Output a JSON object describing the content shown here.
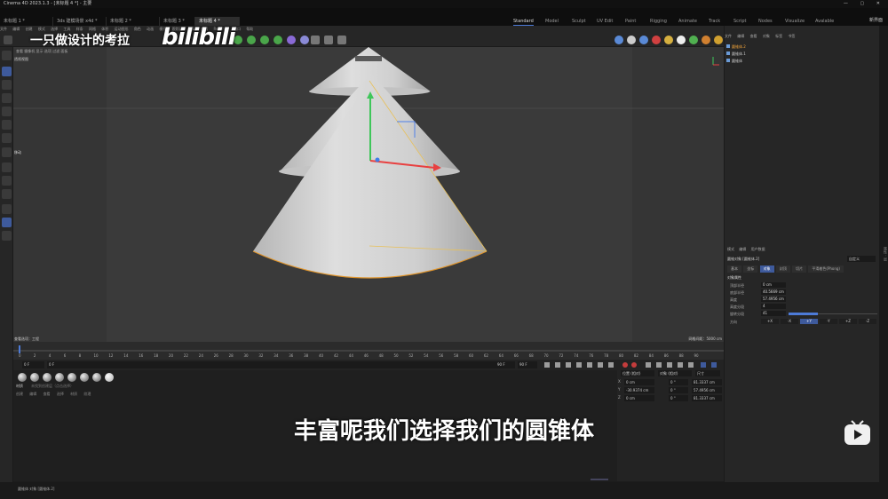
{
  "window": {
    "title": "Cinema 4D 2023.1.3 - [未标题 4 *] - 主要"
  },
  "doc_tabs": [
    {
      "label": "未标题 1 *",
      "active": false
    },
    {
      "label": "3ds 建模场景 x4d *",
      "active": false
    },
    {
      "label": "未标题 2 *",
      "active": false
    },
    {
      "label": "未标题 3 *",
      "active": false
    },
    {
      "label": "未标题 4 *",
      "active": true
    }
  ],
  "layout_tabs": [
    "Standard",
    "Model",
    "Sculpt",
    "UV Edit",
    "Paint",
    "Rigging",
    "Animate",
    "Track",
    "Script",
    "Nodes",
    "Visualize",
    "Avalable"
  ],
  "new_space": "新界面",
  "menu": [
    "文件",
    "编辑",
    "创建",
    "模式",
    "选择",
    "工具",
    "样条",
    "网格",
    "体积",
    "运动图形",
    "角色",
    "动画",
    "模拟",
    "跟踪器",
    "渲染",
    "扩展",
    "Redshift",
    "窗口",
    "帮助"
  ],
  "overlay": {
    "channel_title": "一只做设计的考拉",
    "logo": "bilibili"
  },
  "viewport": {
    "header_menu": "查看  摄像机  显示  选项  过滤  面板",
    "view_name": "透视视图",
    "move_label": "移动",
    "speed_label": "查看选项：工程",
    "grid_label": "网格间距：5000 cm"
  },
  "timeline": {
    "frames": [
      "0",
      "2",
      "4",
      "6",
      "8",
      "10",
      "12",
      "14",
      "16",
      "18",
      "20",
      "22",
      "24",
      "26",
      "28",
      "30",
      "32",
      "34",
      "36",
      "38",
      "40",
      "42",
      "44",
      "46",
      "48",
      "50",
      "52",
      "54",
      "56",
      "58",
      "60",
      "62",
      "64",
      "66",
      "68",
      "70",
      "72",
      "74",
      "76",
      "78",
      "80",
      "82",
      "84",
      "86",
      "88",
      "90"
    ],
    "current": "0 F",
    "start": "0 F",
    "end": "90 F",
    "end2": "90 F"
  },
  "materials": {
    "tab1": "材质",
    "tab2": "未找到创建层（点击选择）",
    "menu": [
      "创建",
      "编辑",
      "查看",
      "选择",
      "材质",
      "纹理"
    ]
  },
  "coords": {
    "headers": {
      "pos": "位置 (相对)",
      "size": "对象 (相对)",
      "mode": "尺寸"
    },
    "rows": [
      {
        "axis": "X",
        "pos": "0 cm",
        "rot": "0 °",
        "size": "81.3337 cm"
      },
      {
        "axis": "Y",
        "pos": "-30.9374 cm",
        "rot": "0 °",
        "size": "57.4956 cm"
      },
      {
        "axis": "Z",
        "pos": "0 cm",
        "rot": "0 °",
        "size": "81.3337 cm"
      }
    ]
  },
  "status": {
    "text": "圆锥体 对象 [圆锥体.2]"
  },
  "subtitle": "丰富呢我们选择我们的圆锥体",
  "objects_panel": {
    "menu": [
      "文件",
      "编辑",
      "查看",
      "对象",
      "标签",
      "书签"
    ],
    "items": [
      {
        "name": "圆锥体.2",
        "selected": true
      },
      {
        "name": "圆锥体.1",
        "selected": false
      },
      {
        "name": "圆锥体",
        "selected": false
      }
    ]
  },
  "attributes": {
    "menu": [
      "模式",
      "编辑",
      "用户数据"
    ],
    "object_name": "圆锥对象 [圆锥体.2]",
    "layer": "自定义",
    "tabs": [
      {
        "label": "基本",
        "active": false
      },
      {
        "label": "坐标",
        "active": false
      },
      {
        "label": "对象",
        "active": true
      },
      {
        "label": "封顶",
        "active": false
      },
      {
        "label": "切片",
        "active": false
      },
      {
        "label": "平滑着色(Phong)",
        "active": false
      }
    ],
    "section": "对象属性",
    "fields": [
      {
        "label": "顶部半径",
        "value": "0 cm"
      },
      {
        "label": "底部半径",
        "value": "40.5669 cm"
      },
      {
        "label": "高度",
        "value": "57.4956 cm"
      },
      {
        "label": "高度分段",
        "value": "4"
      },
      {
        "label": "旋转分段",
        "value": "41"
      }
    ],
    "orientation_label": "方向",
    "orientation_options": [
      "+X",
      "-X",
      "+Y",
      "-Y",
      "+Z",
      "-Z"
    ],
    "orientation_selected": "+Y",
    "rotation_segment_fraction": 0.33
  },
  "vertical_strip": "属性 · 层"
}
